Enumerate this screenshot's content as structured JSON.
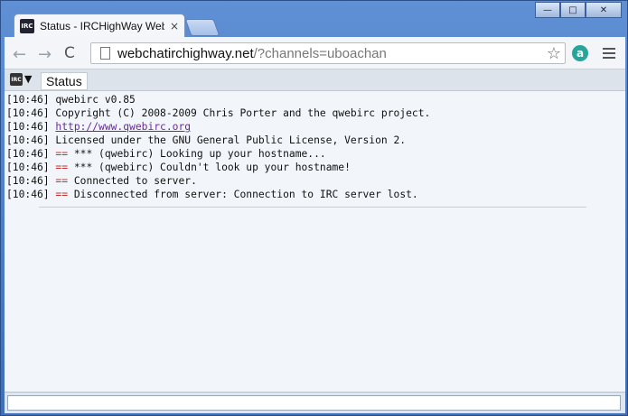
{
  "browser": {
    "tab_title": "Status - IRCHighWay Web",
    "tab_close": "×",
    "favicon_text": "IRC",
    "url_domain": "webchatirchighway.net",
    "url_rest": "/?channels=uboachan",
    "window_controls": {
      "minimize": "—",
      "maximize": "□",
      "close": "✕"
    },
    "icons": {
      "back": "←",
      "forward": "→",
      "reload": "C",
      "star": "☆",
      "ext": "a"
    }
  },
  "irc": {
    "logo_text": "IRC",
    "dropdown": "▼",
    "tab_status": "Status",
    "lines": [
      {
        "ts": "[10:46]",
        "mark": "",
        "text": "qwebirc v0.85",
        "link": ""
      },
      {
        "ts": "[10:46]",
        "mark": "",
        "text": "Copyright (C) 2008-2009 Chris Porter and the qwebirc project.",
        "link": ""
      },
      {
        "ts": "[10:46]",
        "mark": "",
        "text": "",
        "link": "http://www.qwebirc.org"
      },
      {
        "ts": "[10:46]",
        "mark": "",
        "text": "Licensed under the GNU General Public License, Version 2.",
        "link": ""
      },
      {
        "ts": "[10:46]",
        "mark": "==",
        "text": "*** (qwebirc) Looking up your hostname...",
        "link": ""
      },
      {
        "ts": "[10:46]",
        "mark": "==",
        "text": "*** (qwebirc) Couldn't look up your hostname!",
        "link": ""
      },
      {
        "ts": "[10:46]",
        "mark": "==",
        "text": "Connected to server.",
        "link": ""
      },
      {
        "ts": "[10:46]",
        "mark": "==",
        "text": "Disconnected from server: Connection to IRC server lost.",
        "link": ""
      }
    ]
  }
}
